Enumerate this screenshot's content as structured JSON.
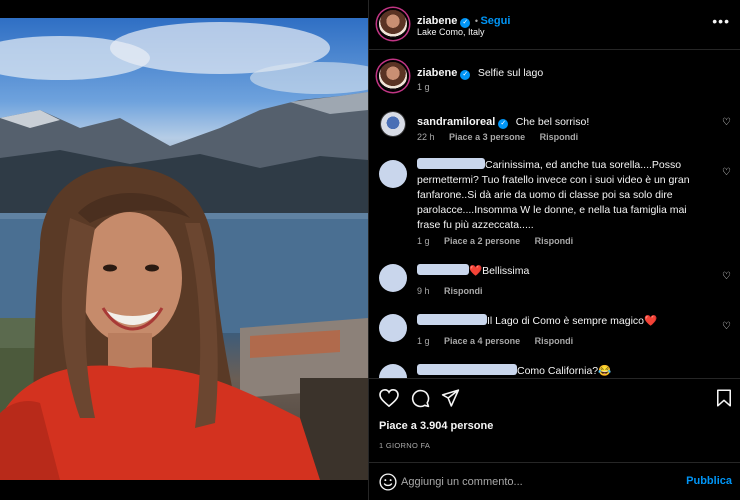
{
  "post": {
    "username": "ziabene",
    "follow_label": "Segui",
    "location": "Lake Como, Italy",
    "more_icon": "more-horizontal-icon"
  },
  "caption": {
    "username": "ziabene",
    "text": "Selfie sul lago",
    "time": "1 g"
  },
  "comments": [
    {
      "username": "sandramiloreal",
      "verified": true,
      "text": "Che bel sorriso!",
      "time": "22 h",
      "likes": "Piace a 3 persone",
      "reply": "Rispondi"
    },
    {
      "username": "",
      "text": "Carinissima, ed anche tua sorella....Posso permettermi? Tuo fratello invece con i suoi video è un gran fanfarone..Si dà arie da uomo di classe poi sa solo dire parolacce....Insomma W le donne, e nella tua famiglia mai frase fu più azzeccata.....",
      "time": "1 g",
      "likes": "Piace a 2 persone",
      "reply": "Rispondi"
    },
    {
      "username": "",
      "text": "❤️Bellissima",
      "time": "9 h",
      "likes": "",
      "reply": "Rispondi"
    },
    {
      "username": "",
      "text": "Il Lago di Como è sempre magico❤️",
      "time": "1 g",
      "likes": "Piace a 4 persone",
      "reply": "Rispondi"
    },
    {
      "username": "",
      "text": "Como California?😂",
      "time": "",
      "likes": "",
      "reply": ""
    }
  ],
  "actions": {
    "likes_text": "Piace a 3.904 persone",
    "date_text": "1 GIORNO FA"
  },
  "composer": {
    "placeholder": "Aggiungi un commento...",
    "publish_label": "Pubblica"
  },
  "icons": [
    "heart-icon",
    "comment-icon",
    "share-icon",
    "bookmark-icon",
    "emoji-icon",
    "verified-icon"
  ]
}
